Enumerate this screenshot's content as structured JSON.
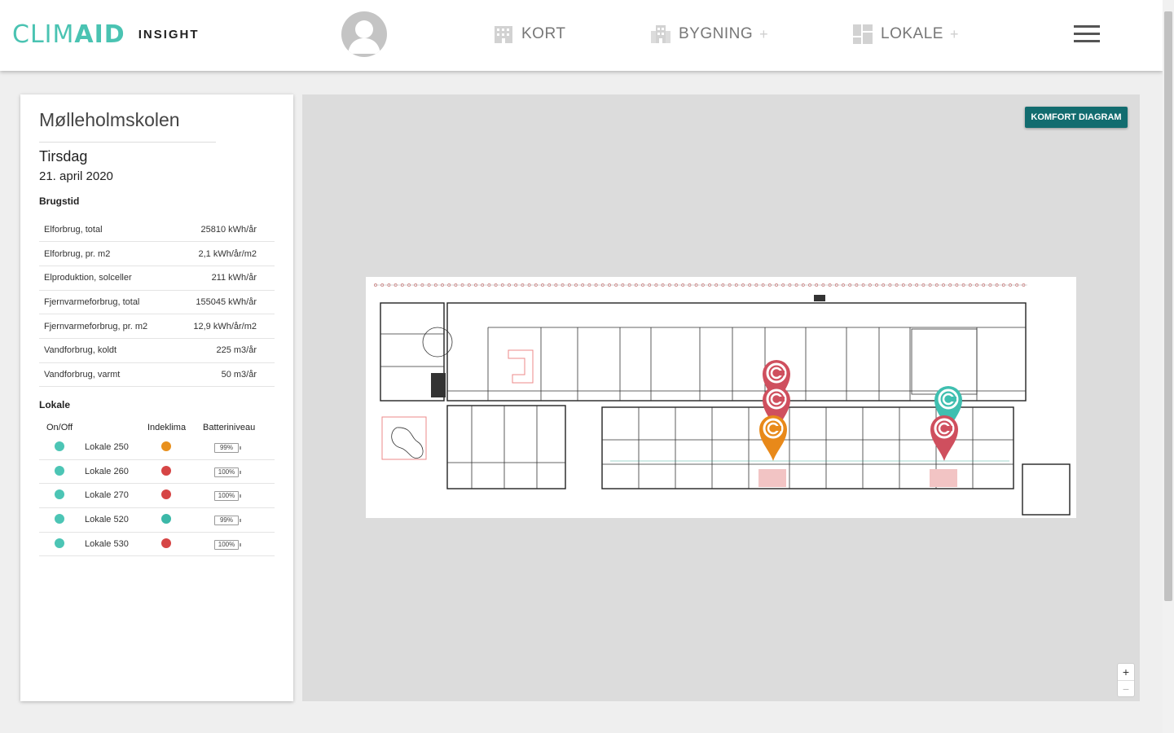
{
  "header": {
    "logo_light": "CLIM",
    "logo_bold": "AID",
    "subtitle": "INSIGHT",
    "nav": [
      {
        "label": "KORT",
        "icon": "building-icon",
        "has_plus": false
      },
      {
        "label": "BYGNING",
        "icon": "buildings-icon",
        "has_plus": true
      },
      {
        "label": "LOKALE",
        "icon": "room-grid-icon",
        "has_plus": true
      }
    ],
    "plus_symbol": "+",
    "menu_icon": "hamburger-icon"
  },
  "sidebar": {
    "building_name": "Mølleholmskolen",
    "weekday": "Tirsdag",
    "date": "21. april 2020",
    "usage_title": "Brugstid",
    "usage": [
      {
        "label": "Elforbrug, total",
        "value": "25810 kWh/år"
      },
      {
        "label": "Elforbrug, pr. m2",
        "value": "2,1 kWh/år/m2"
      },
      {
        "label": "Elproduktion, solceller",
        "value": "211 kWh/år"
      },
      {
        "label": "Fjernvarmeforbrug, total",
        "value": "155045 kWh/år"
      },
      {
        "label": "Fjernvarmeforbrug, pr. m2",
        "value": "12,9 kWh/år/m2"
      },
      {
        "label": "Vandforbrug, koldt",
        "value": "225 m3/år"
      },
      {
        "label": "Vandforbrug, varmt",
        "value": "50 m3/år"
      }
    ],
    "rooms_title": "Lokale",
    "rooms_columns": {
      "onoff": "On/Off",
      "klima": "Indeklima",
      "battery": "Batteriniveau"
    },
    "rooms": [
      {
        "name": "Lokale 250",
        "onoff_color": "#4cc5b5",
        "klima_color": "#e8901e",
        "battery": "99%"
      },
      {
        "name": "Lokale 260",
        "onoff_color": "#4cc5b5",
        "klima_color": "#d64545",
        "battery": "100%"
      },
      {
        "name": "Lokale 270",
        "onoff_color": "#4cc5b5",
        "klima_color": "#d64545",
        "battery": "100%"
      },
      {
        "name": "Lokale 520",
        "onoff_color": "#4cc5b5",
        "klima_color": "#3bb8a8",
        "battery": "99%"
      },
      {
        "name": "Lokale 530",
        "onoff_color": "#4cc5b5",
        "klima_color": "#d64545",
        "battery": "100%"
      }
    ]
  },
  "map": {
    "button_label": "KOMFORT DIAGRAM",
    "zoom_in": "+",
    "zoom_out": "−",
    "markers": [
      {
        "color": "#cf4f5e"
      },
      {
        "color": "#cf4f5e"
      },
      {
        "color": "#e8891a"
      },
      {
        "color": "#3fbfb0"
      },
      {
        "color": "#cf4f5e"
      }
    ]
  },
  "colors": {
    "brand": "#4ac3b2",
    "button": "#126c6f",
    "status_red": "#d64545",
    "status_orange": "#e8901e",
    "status_teal": "#4cc5b5"
  }
}
